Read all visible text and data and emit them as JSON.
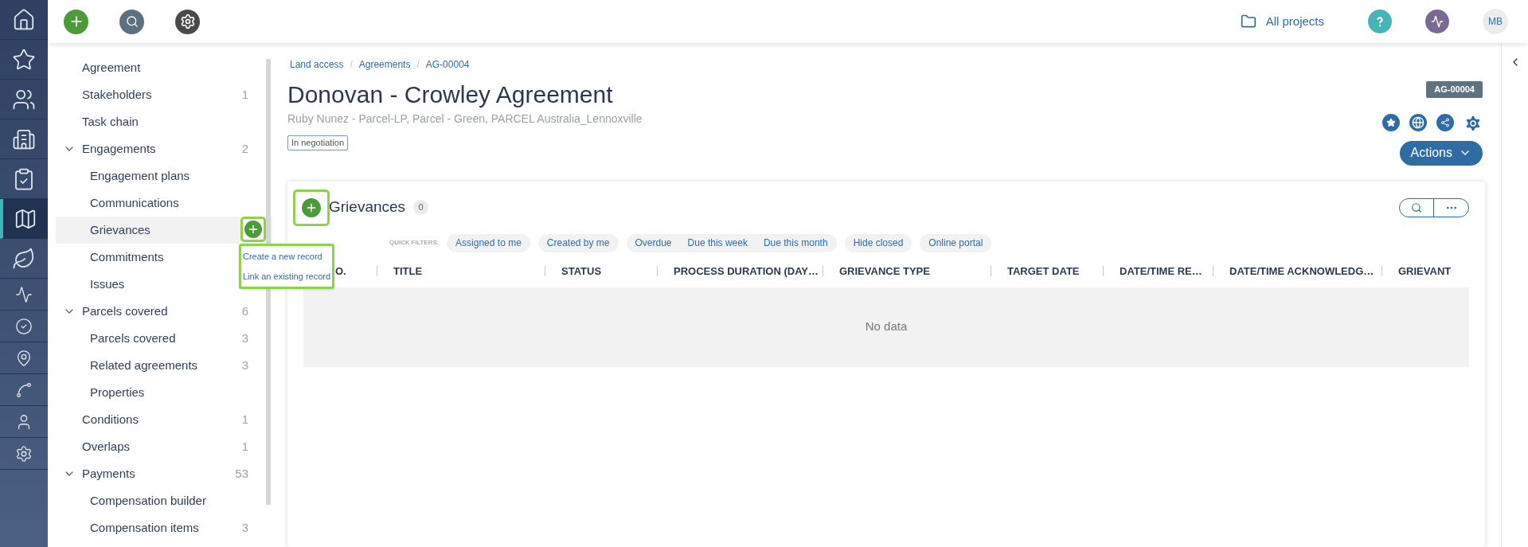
{
  "top_bar": {
    "project_selector": "All projects",
    "avatar": "MB"
  },
  "rail": [
    {
      "selected": false
    },
    {
      "selected": false
    },
    {
      "selected": false
    },
    {
      "selected": false
    },
    {
      "selected": false
    },
    {
      "selected": true
    },
    {
      "selected": false
    },
    {
      "selected": false
    },
    {
      "selected": false
    },
    {
      "selected": false
    },
    {
      "selected": false
    },
    {
      "selected": false
    },
    {
      "selected": false
    }
  ],
  "sidebar": {
    "items": [
      {
        "label": "Agreement",
        "selected": false
      },
      {
        "label": "Stakeholders",
        "count": "1",
        "selected": false
      },
      {
        "label": "Task chain",
        "selected": false
      },
      {
        "label": "Engagements",
        "count": "2",
        "selected": false,
        "expanded": true,
        "children": [
          {
            "label": "Engagement plans",
            "selected": false
          },
          {
            "label": "Communications",
            "selected": false
          },
          {
            "label": "Grievances",
            "selected": true
          },
          {
            "label": "Commitments",
            "selected": false
          },
          {
            "label": "Issues",
            "selected": false
          }
        ]
      },
      {
        "label": "Parcels covered",
        "count": "6",
        "selected": false,
        "expanded": true,
        "children": [
          {
            "label": "Parcels covered",
            "count": "3",
            "selected": false
          },
          {
            "label": "Related agreements",
            "count": "3",
            "selected": false
          },
          {
            "label": "Properties",
            "selected": false
          }
        ]
      },
      {
        "label": "Conditions",
        "count": "1",
        "selected": false
      },
      {
        "label": "Overlaps",
        "count": "1",
        "selected": false
      },
      {
        "label": "Payments",
        "count": "53",
        "selected": false,
        "expanded": true,
        "children": [
          {
            "label": "Compensation builder",
            "selected": false
          },
          {
            "label": "Compensation items",
            "count": "3",
            "selected": false
          }
        ]
      }
    ]
  },
  "add_menu": {
    "items": [
      "Create a new record",
      "Link an existing record"
    ]
  },
  "breadcrumbs": [
    "Land access",
    "Agreements",
    "AG-00004"
  ],
  "breadcrumb_separator": "/",
  "title": "Donovan - Crowley Agreement",
  "subtitle": "Ruby Nunez - Parcel-LP, Parcel - Green, PARCEL Australia_Lennoxville",
  "status_badge": "In negotiation",
  "id_badge": "AG-00004",
  "actions_button": "Actions",
  "panel": {
    "title": "Grievances",
    "count": "0",
    "quick_filters_label": "QUICK FILTERS:",
    "filter_groups": [
      [
        "Assigned to me"
      ],
      [
        "Created by me"
      ],
      [
        "Overdue",
        "Due this week",
        "Due this month"
      ],
      [
        "Hide closed"
      ],
      [
        "Online portal"
      ]
    ],
    "columns": [
      "O.",
      "TITLE",
      "STATUS",
      "PROCESS DURATION (DAY…",
      "GRIEVANCE TYPE",
      "TARGET DATE",
      "DATE/TIME RE…",
      "DATE/TIME ACKNOWLEDG…",
      "GRIEVANT"
    ],
    "empty_text": "No data"
  }
}
